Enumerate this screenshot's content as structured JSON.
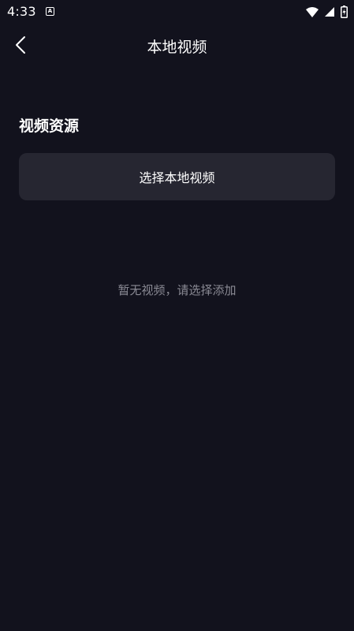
{
  "status_bar": {
    "time": "4:33",
    "notification_icon": "a-notification-icon",
    "wifi_icon": "wifi-icon",
    "signal_icon": "cell-signal-icon",
    "battery_icon": "battery-charging-icon"
  },
  "header": {
    "back_icon": "chevron-left-icon",
    "title": "本地视频"
  },
  "section": {
    "title": "视频资源",
    "select_button_label": "选择本地视频"
  },
  "empty_state": {
    "message": "暂无视频，请选择添加"
  },
  "colors": {
    "background": "#12121d",
    "button_background": "#262631",
    "muted_text": "#8a8a94",
    "text": "#ffffff"
  }
}
